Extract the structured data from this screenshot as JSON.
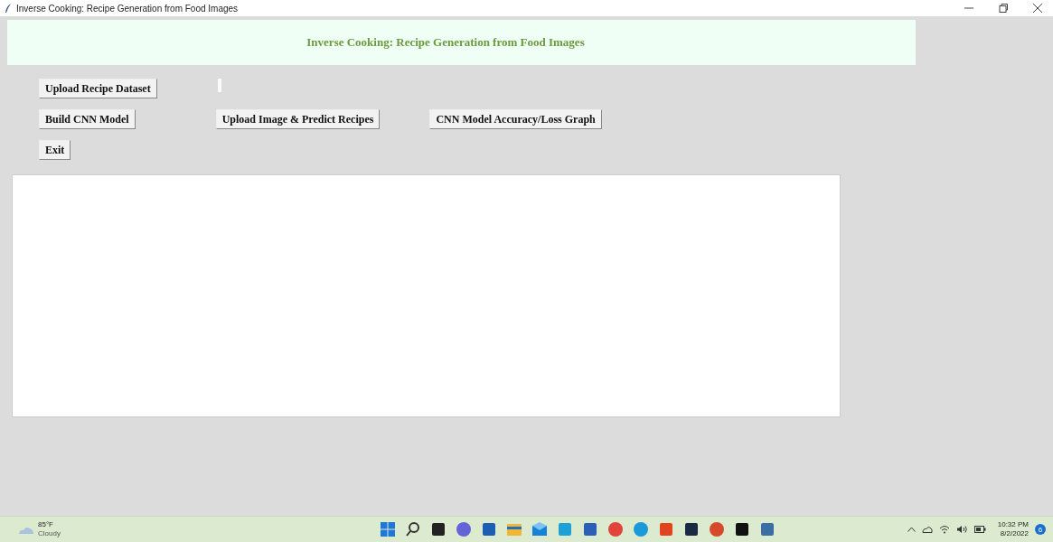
{
  "window": {
    "title": "Inverse Cooking: Recipe Generation from Food Images"
  },
  "heading": "Inverse Cooking: Recipe Generation from Food Images",
  "button_rows": [
    [
      {
        "label": "Upload Recipe Dataset"
      }
    ],
    [
      {
        "label": "Build CNN Model"
      },
      {
        "label": "Upload Image & Predict Recipes"
      },
      {
        "label": "CNN Model Accuracy/Loss Graph"
      }
    ],
    [
      {
        "label": "Exit"
      }
    ]
  ],
  "taskbar": {
    "weather": {
      "temperature": "85°F",
      "condition": "Cloudy"
    },
    "time": "10:32 PM",
    "date": "8/2/2022",
    "notifications": "6"
  }
}
